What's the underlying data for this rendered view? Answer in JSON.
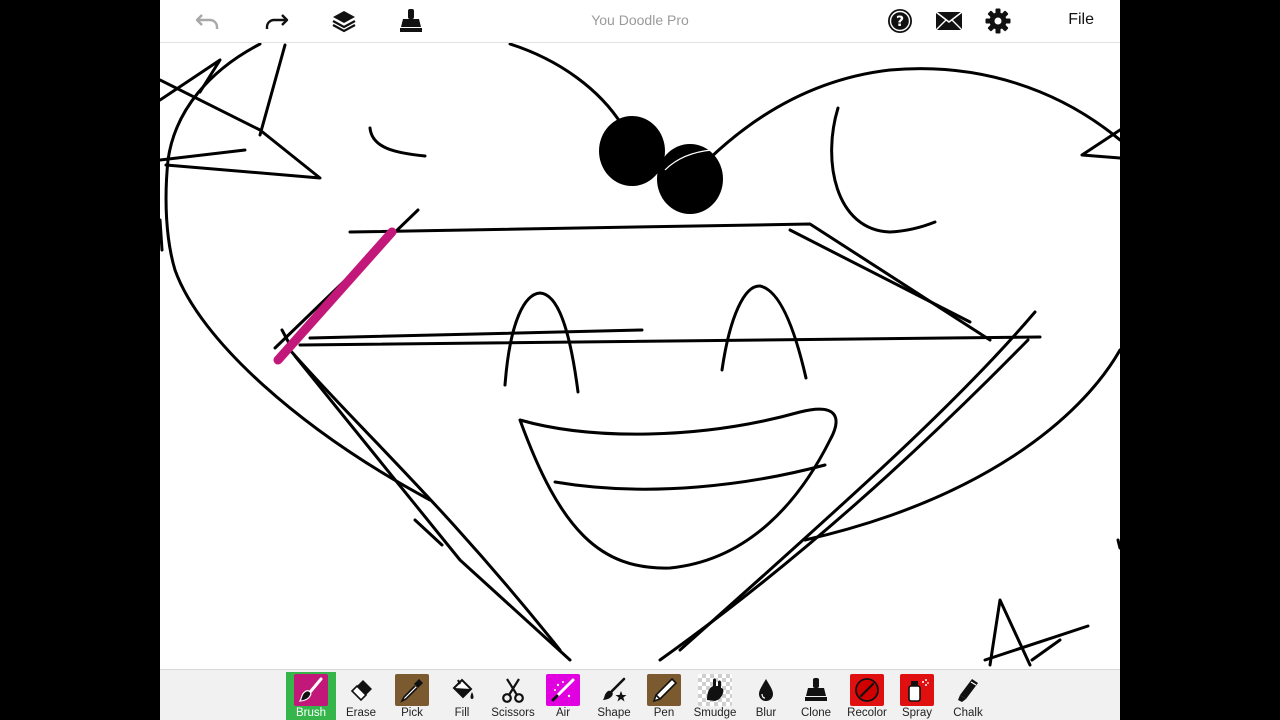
{
  "app": {
    "title": "You Doodle Pro",
    "file_label": "File"
  },
  "topbar": {
    "left_icons": [
      "undo-icon",
      "redo-icon",
      "layers-icon",
      "stamp-icon"
    ],
    "right_icons": [
      "help-icon",
      "mail-icon",
      "gear-icon"
    ]
  },
  "toolbar": {
    "active_tool": "Brush",
    "tools": [
      {
        "label": "Brush",
        "icon": "brush-icon",
        "color": "#c2187a"
      },
      {
        "label": "Erase",
        "icon": "eraser-icon",
        "color": ""
      },
      {
        "label": "Pick",
        "icon": "eyedropper-icon",
        "color": "#7a5a2e"
      },
      {
        "label": "Fill",
        "icon": "paint-bucket-icon",
        "color": ""
      },
      {
        "label": "Scissors",
        "icon": "scissors-icon",
        "color": ""
      },
      {
        "label": "Air",
        "icon": "airbrush-icon",
        "color": "#e000e0"
      },
      {
        "label": "Shape",
        "icon": "shape-icon",
        "color": ""
      },
      {
        "label": "Pen",
        "icon": "pen-icon",
        "color": "#7a5a2e"
      },
      {
        "label": "Smudge",
        "icon": "smudge-icon",
        "color": ""
      },
      {
        "label": "Blur",
        "icon": "blur-drop-icon",
        "color": ""
      },
      {
        "label": "Clone",
        "icon": "clone-stamp-icon",
        "color": ""
      },
      {
        "label": "Recolor",
        "icon": "recolor-icon",
        "color": "#e01010"
      },
      {
        "label": "Spray",
        "icon": "spray-can-icon",
        "color": "#e01010"
      },
      {
        "label": "Chalk",
        "icon": "chalk-icon",
        "color": ""
      }
    ]
  },
  "canvas": {
    "stroke_color": "#000000",
    "highlight_color": "#c2187a"
  }
}
